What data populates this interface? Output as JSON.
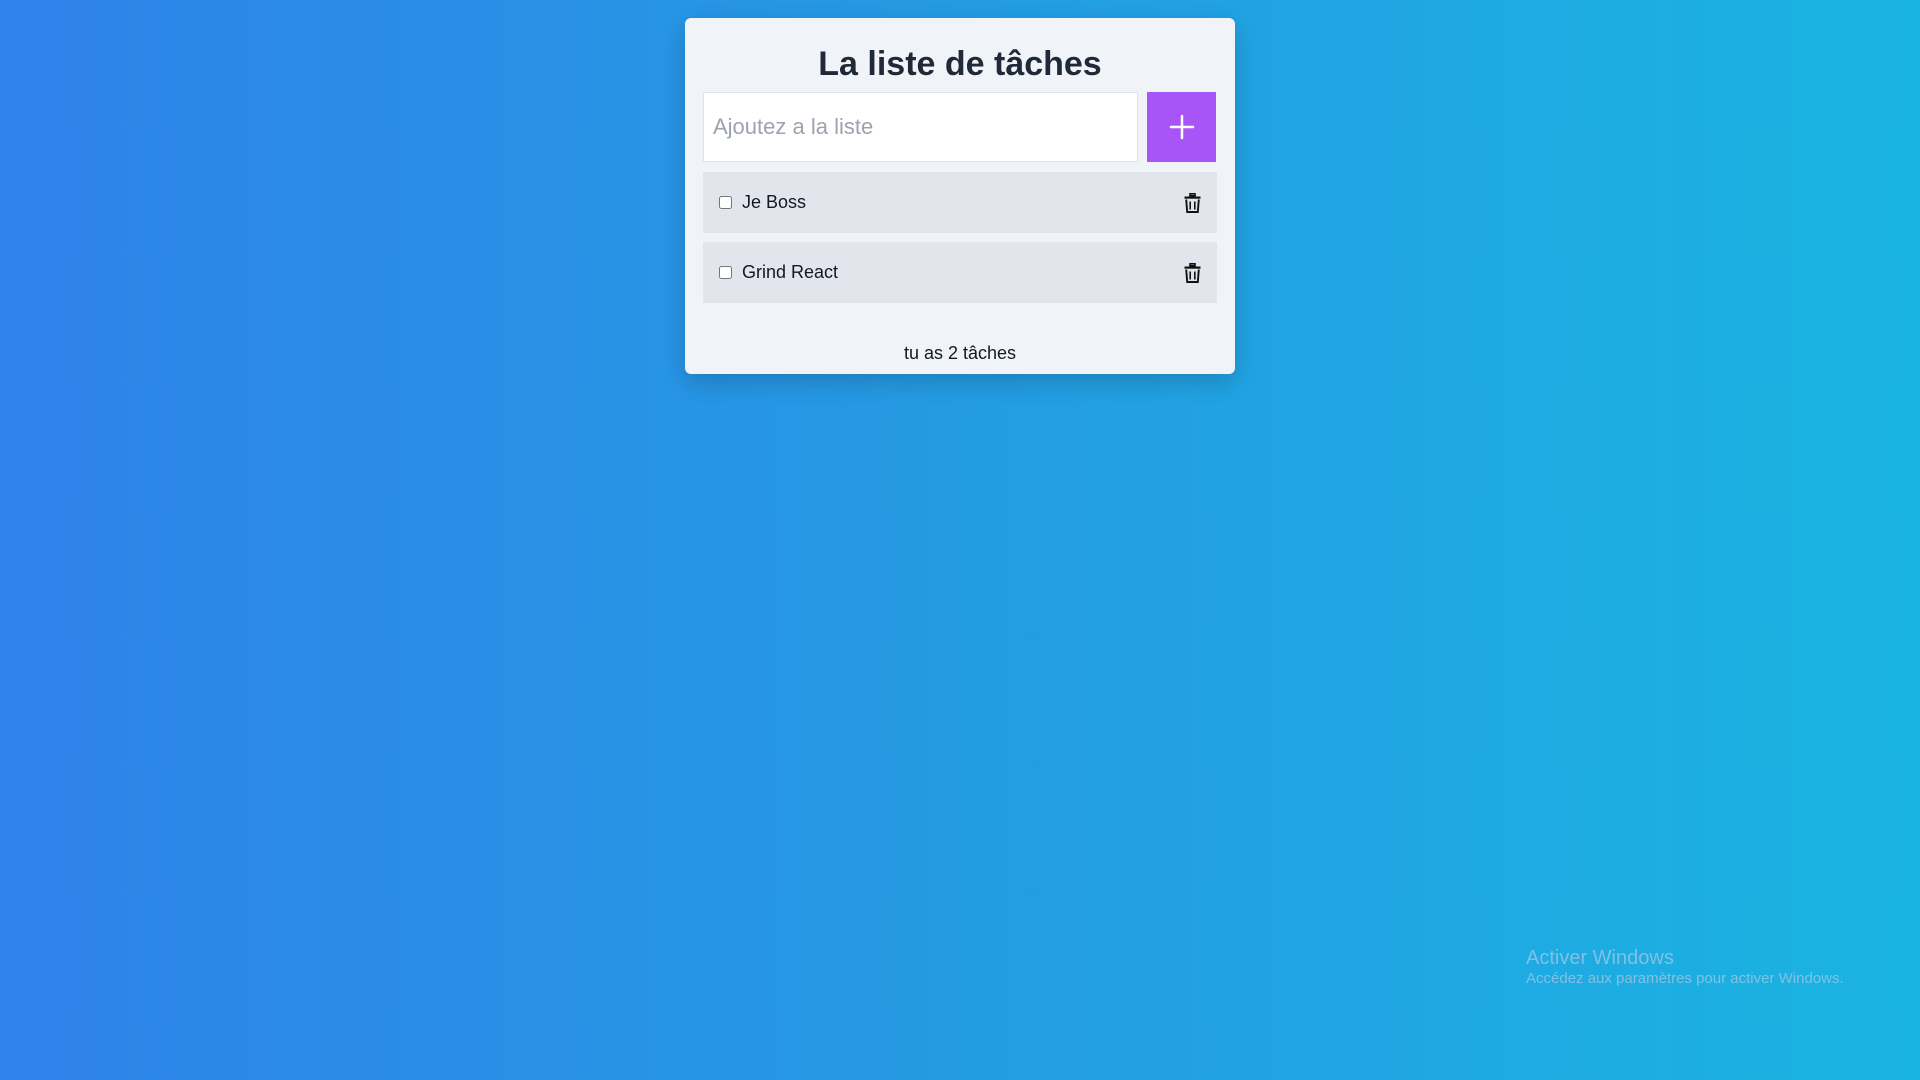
{
  "app": {
    "title": "La liste de tâches"
  },
  "add_form": {
    "placeholder": "Ajoutez a la liste",
    "value": "",
    "add_icon": "plus-icon"
  },
  "tasks": [
    {
      "label": "Je Boss",
      "checked": false,
      "delete_icon": "trash-icon"
    },
    {
      "label": "Grind React",
      "checked": false,
      "delete_icon": "trash-icon"
    }
  ],
  "footer": {
    "count_text": "tu as 2 tâches"
  },
  "os_watermark": {
    "title": "Activer Windows",
    "subtitle": "Accédez aux paramètres pour activer Windows."
  },
  "colors": {
    "accent": "#a855f7",
    "card_background": "#f0f4f9",
    "item_background": "#e2e6ec",
    "page_gradient_start": "#2f82ea",
    "page_gradient_end": "#1ab4e1"
  }
}
